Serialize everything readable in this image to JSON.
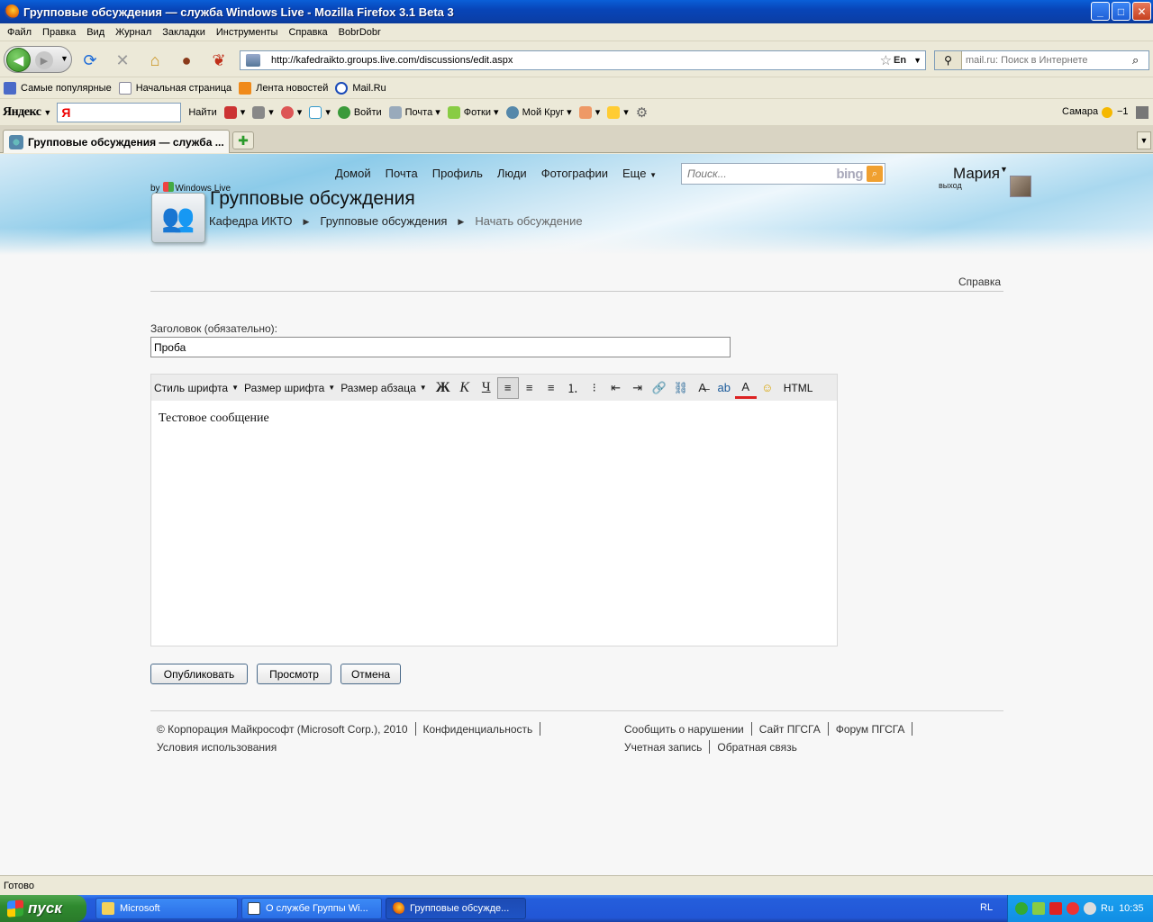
{
  "window": {
    "title": "Групповые обсуждения — служба Windows Live - Mozilla Firefox 3.1 Beta 3",
    "controls": {
      "minimize": "_",
      "maximize": "□",
      "close": "✕"
    }
  },
  "menu": [
    "Файл",
    "Правка",
    "Вид",
    "Журнал",
    "Закладки",
    "Инструменты",
    "Справка",
    "BobrDobr"
  ],
  "nav": {
    "url": "http://kafedraikto.groups.live.com/discussions/edit.aspx",
    "lang": "En",
    "search_placeholder": "mail.ru: Поиск в Интернете"
  },
  "bookmarks": [
    "Самые популярные",
    "Начальная страница",
    "Лента новостей",
    "Mail.Ru"
  ],
  "yandex": {
    "logo": "Яндекс",
    "input_value": "Я",
    "find": "Найти",
    "login": "Войти",
    "mail": "Почта",
    "photos": "Фотки",
    "circle": "Мой Круг",
    "city": "Самара",
    "temp": "−1"
  },
  "tabs": [
    {
      "label": "Групповые обсуждения — служба ..."
    }
  ],
  "wl": {
    "nav": [
      "Домой",
      "Почта",
      "Профиль",
      "Люди",
      "Фотографии",
      "Еще"
    ],
    "search_placeholder": "Поиск...",
    "bing": "bing",
    "user_name": "Мария",
    "signout": "выход",
    "by": "by",
    "brand": "Windows Live",
    "page_title": "Групповые обсуждения",
    "breadcrumb": [
      "Кафедра ИКТО",
      "Групповые обсуждения",
      "Начать обсуждение"
    ],
    "help": "Справка"
  },
  "form": {
    "title_label": "Заголовок (обязательно):",
    "title_value": "Проба",
    "toolbar": {
      "font_style": "Стиль шрифта",
      "font_size": "Размер шрифта",
      "paragraph": "Размер абзаца",
      "bold": "Ж",
      "italic": "К",
      "underline": "Ч",
      "html": "HTML"
    },
    "body": "Тестовое сообщение",
    "buttons": {
      "publish": "Опубликовать",
      "preview": "Просмотр",
      "cancel": "Отмена"
    }
  },
  "footer": {
    "copyright": "© Корпорация Майкрософт (Microsoft Corp.), 2010",
    "privacy": "Конфиденциальность",
    "terms": "Условия использования",
    "report": "Сообщить о нарушении",
    "site": "Сайт ПГСГА",
    "forum": "Форум ПГСГА",
    "account": "Учетная запись",
    "feedback": "Обратная связь"
  },
  "status": "Готово",
  "taskbar": {
    "start": "пуск",
    "tasks": [
      "Microsoft",
      "О службе Группы Wi...",
      "Групповые обсужде..."
    ],
    "lang": "RL",
    "tray_lang": "Ru",
    "clock": "10:35"
  },
  "colors": {
    "accent_blue": "#0a5fd8",
    "start_green": "#2f8a2f",
    "bing_orange": "#f0a030"
  }
}
